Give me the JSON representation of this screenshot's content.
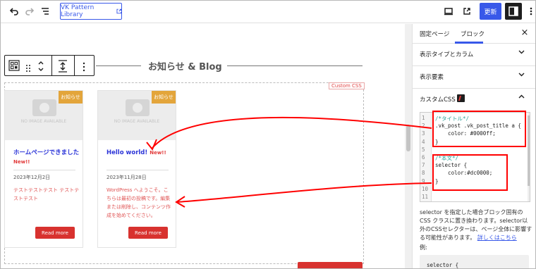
{
  "toolbar": {
    "pattern_label": "VK Pattern Library",
    "update_label": "更新"
  },
  "canvas": {
    "heading": "お知らせ & Blog",
    "custom_css_tag": "Custom CSS",
    "posts": [
      {
        "badge": "お知らせ",
        "title": "ホームページできました",
        "new_label": "New!!",
        "date": "2023年12月2日",
        "excerpt": "テストテストテスト テストテストテスト",
        "read_more": "Read more",
        "no_image": "NO IMAGE AVAILABLE"
      },
      {
        "badge": "お知らせ",
        "title": "Hello world!",
        "new_label": "New!!",
        "date": "2023年11月28日",
        "excerpt": "WordPress へようこそ。こちらは最初の投稿です。編集または削除し、コンテンツ作成を始めてください。",
        "read_more": "Read more",
        "no_image": "NO IMAGE AVAILABLE"
      }
    ]
  },
  "sidebar": {
    "tabs": [
      "固定ページ",
      "ブロック"
    ],
    "panels": [
      "表示タイプとカラム",
      "表示要素",
      "カスタムCSS"
    ],
    "code_lines": [
      "/*タイトル*/",
      ".vk_post .vk_post_title a {",
      "    color: #0000ff;",
      "}",
      "",
      "/*本文*/",
      "selector {",
      "    color:#dc0000;",
      "}",
      "",
      ""
    ],
    "line_numbers": [
      "1",
      "2",
      "3",
      "4",
      "5",
      "6",
      "7",
      "8",
      "9",
      "10",
      "11"
    ],
    "help_text": "selector を指定した場合ブロック固有の CSS クラスに置き換わります。selector以外のCSSセレクターは、ページ全体に影響する可能性があります。",
    "help_link": "詳しくはこちら",
    "example_label": "例:",
    "example_code": "selector {"
  },
  "colors": {
    "accent": "#3858e9",
    "badge": "#e3a53b",
    "button": "#d8322f",
    "annotation": "#ff0000"
  }
}
